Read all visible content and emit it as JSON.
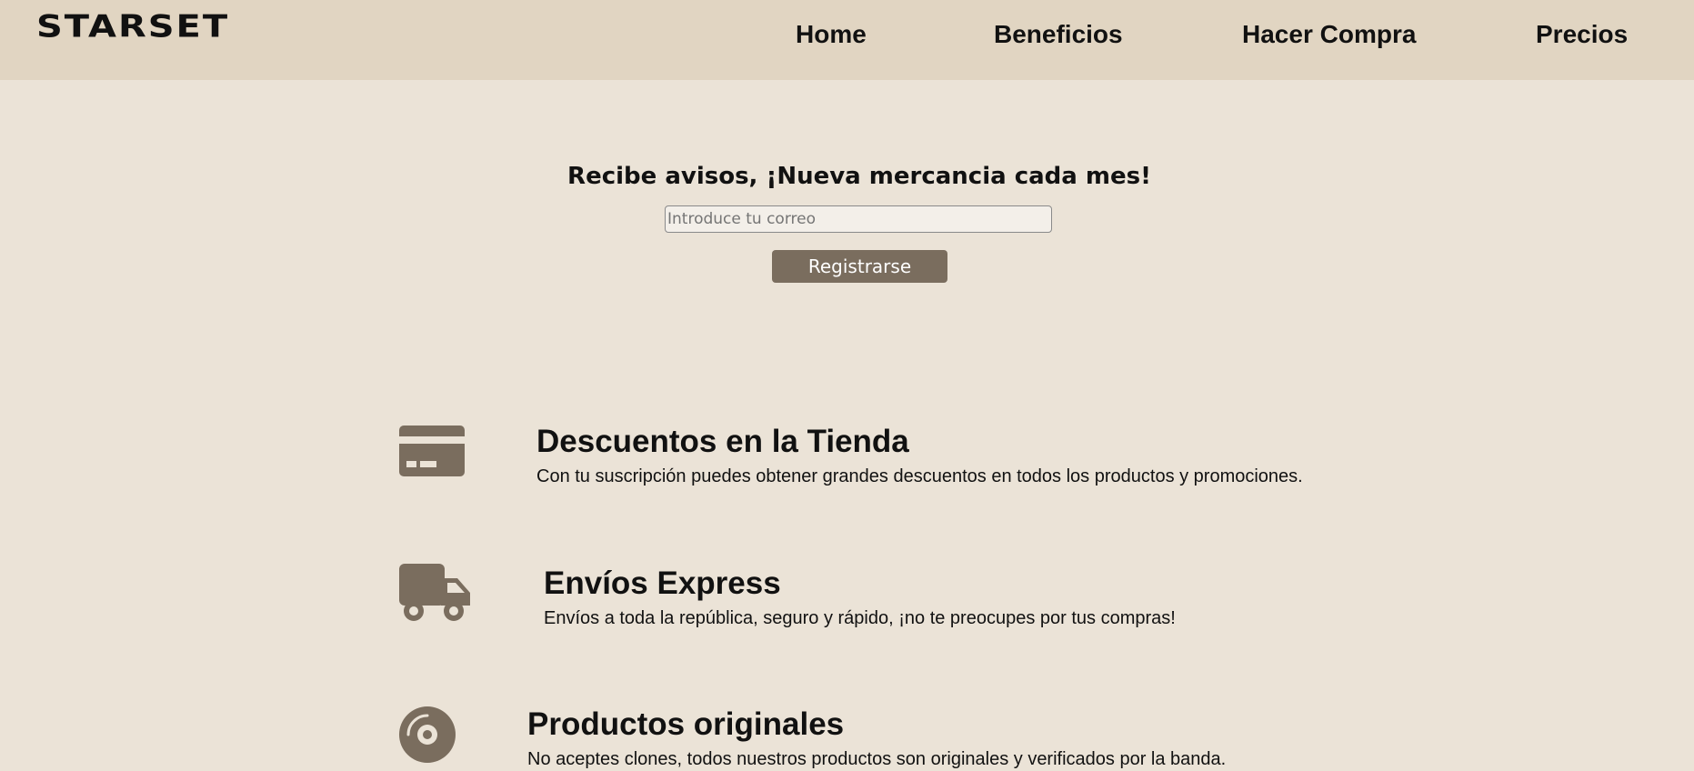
{
  "navbar": {
    "logo": "STARSET",
    "links": [
      "Home",
      "Beneficios",
      "Hacer Compra",
      "Precios"
    ]
  },
  "signup": {
    "title": "Recibe avisos, ¡Nueva mercancia cada mes!",
    "email_placeholder": "Introduce tu correo",
    "button_label": "Registrarse"
  },
  "features": [
    {
      "icon": "credit-card-icon",
      "title": "Descuentos en la Tienda",
      "description": "Con tu suscripción puedes obtener grandes descuentos en todos los productos y promociones."
    },
    {
      "icon": "truck-icon",
      "title": "Envíos Express",
      "description": "Envíos a toda la república, seguro y rápido, ¡no te preocupes por tus compras!"
    },
    {
      "icon": "disc-icon",
      "title": "Productos originales",
      "description": "No aceptes clones, todos nuestros productos son originales y verificados por la banda."
    }
  ],
  "colors": {
    "background": "#ebe3d7",
    "navbar": "#e1d5c2",
    "accent": "#7a6d5e"
  }
}
